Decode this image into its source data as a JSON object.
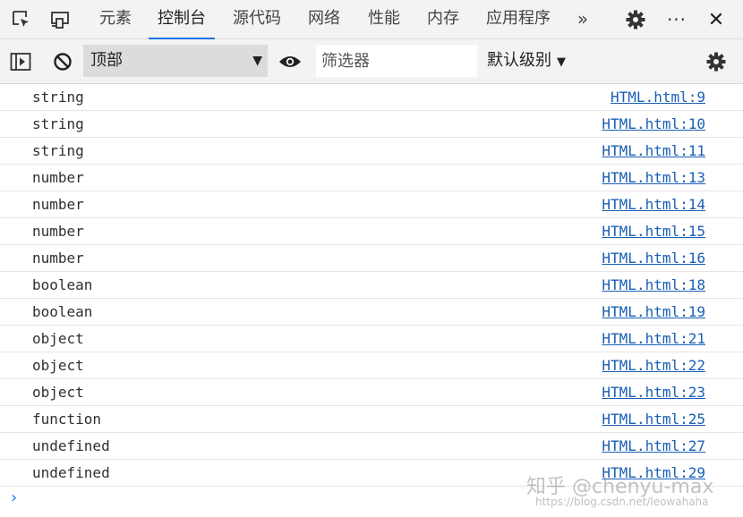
{
  "tabs": [
    {
      "label": "元素"
    },
    {
      "label": "控制台",
      "active": true
    },
    {
      "label": "源代码"
    },
    {
      "label": "网络"
    },
    {
      "label": "性能"
    },
    {
      "label": "内存"
    },
    {
      "label": "应用程序"
    }
  ],
  "more_tabs_glyph": "»",
  "more_menu_glyph": "···",
  "close_glyph": "✕",
  "toolbar": {
    "context_select_value": "顶部",
    "filter_placeholder": "筛选器",
    "level_label": "默认级别",
    "dropdown_glyph": "▼"
  },
  "log": [
    {
      "message": "string",
      "source": "HTML.html:9"
    },
    {
      "message": "string",
      "source": "HTML.html:10"
    },
    {
      "message": "string",
      "source": "HTML.html:11"
    },
    {
      "message": "number",
      "source": "HTML.html:13"
    },
    {
      "message": "number",
      "source": "HTML.html:14"
    },
    {
      "message": "number",
      "source": "HTML.html:15"
    },
    {
      "message": "number",
      "source": "HTML.html:16"
    },
    {
      "message": "boolean",
      "source": "HTML.html:18"
    },
    {
      "message": "boolean",
      "source": "HTML.html:19"
    },
    {
      "message": "object",
      "source": "HTML.html:21"
    },
    {
      "message": "object",
      "source": "HTML.html:22"
    },
    {
      "message": "object",
      "source": "HTML.html:23"
    },
    {
      "message": "function",
      "source": "HTML.html:25"
    },
    {
      "message": "undefined",
      "source": "HTML.html:27"
    },
    {
      "message": "undefined",
      "source": "HTML.html:29"
    }
  ],
  "prompt_glyph": "›",
  "watermark": "知乎 @chenyu-max",
  "watermark_url": "https://blog.csdn.net/leowahaha",
  "colors": {
    "accent": "#1a73e8",
    "link": "#1a5fb4",
    "toolbar_bg": "#f3f3f3"
  }
}
